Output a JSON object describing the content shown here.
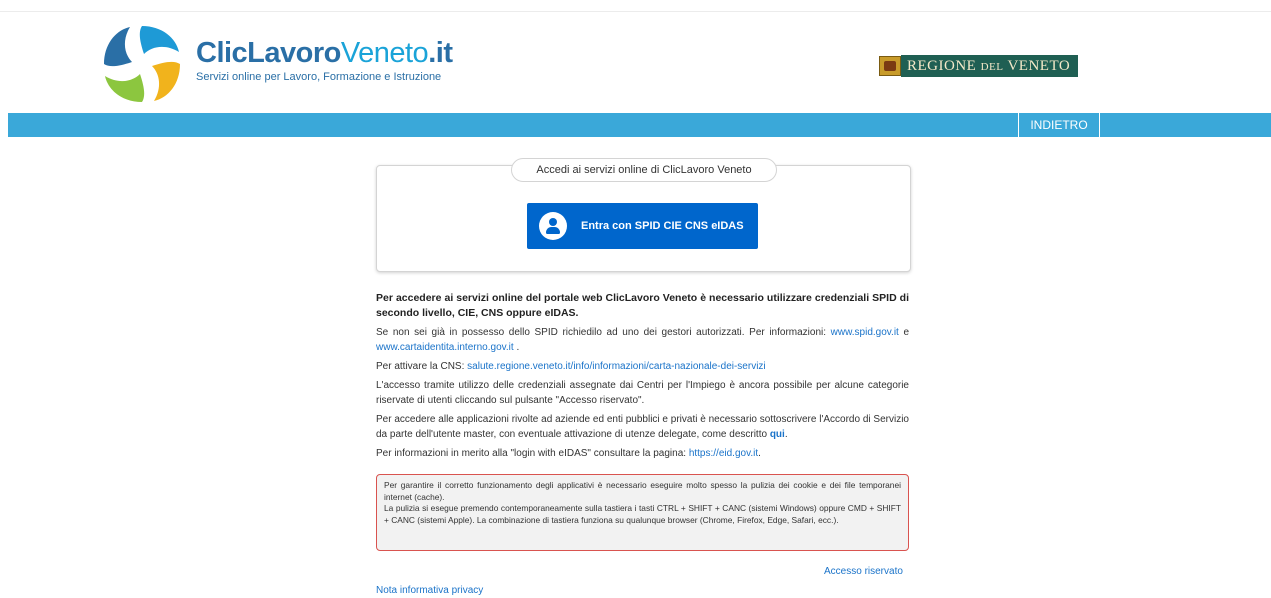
{
  "header": {
    "brand_main": "ClicLavoro",
    "brand_accent": "Veneto",
    "brand_suffix": ".it",
    "brand_subtitle": "Servizi online per Lavoro, Formazione e Istruzione",
    "logo_icon": "swirl-logo-icon",
    "regione_label_1": "REGIONE ",
    "regione_label_2": "DEL",
    "regione_label_3": " VENETO"
  },
  "nav": {
    "back_label": "INDIETRO",
    "bar_color": "#3aa8d9"
  },
  "login": {
    "legend": "Accedi ai servizi online di ClicLavoro Veneto",
    "button_label": "Entra con SPID CIE CNS eIDAS",
    "button_icon": "user-icon",
    "button_color": "#0066cc"
  },
  "content": {
    "intro": "Per accedere ai servizi online del portale web ClicLavoro Veneto è necessario utilizzare credenziali SPID di secondo livello, CIE, CNS oppure eIDAS.",
    "spid_text": "Se non sei già in possesso dello SPID richiedilo ad uno dei gestori autorizzati. Per informazioni: ",
    "spid_link": "www.spid.gov.it",
    "spid_and": " e ",
    "cie_link": "www.cartaidentita.interno.gov.it",
    "cie_dot": " .",
    "cns_text": "Per attivare la CNS: ",
    "cns_link": "salute.regione.veneto.it/info/informazioni/carta-nazionale-dei-servizi",
    "cpi_text": "L'accesso tramite utilizzo delle credenziali assegnate dai Centri per l'Impiego è ancora possibile per alcune categorie riservate di utenti cliccando sul pulsante \"Accesso riservato\".",
    "aziende_text": "Per accedere alle applicazioni rivolte ad aziende ed enti pubblici e privati è necessario sottoscrivere l'Accordo di Servizio da parte dell'utente master, con eventuale attivazione di utenze delegate, come descritto ",
    "aziende_link": "qui",
    "aziende_dot": ".",
    "eidas_text": "Per informazioni in merito alla \"login with eIDAS\" consultare la pagina: ",
    "eidas_link": "https://eid.gov.it",
    "eidas_dot": "."
  },
  "warning": {
    "line1": "Per garantire il corretto funzionamento degli applicativi è necessario eseguire molto spesso la pulizia dei cookie e dei file temporanei internet (cache).",
    "line2": "La pulizia si esegue premendo contemporaneamente sulla tastiera i tasti CTRL + SHIFT + CANC (sistemi Windows) oppure CMD + SHIFT + CANC (sistemi Apple). La combinazione di tastiera funziona su qualunque browser (Chrome, Firefox, Edge, Safari, ecc.).",
    "border_color": "#d9534f"
  },
  "footer": {
    "reserved_link": "Accesso riservato",
    "privacy_link": "Nota informativa privacy"
  }
}
